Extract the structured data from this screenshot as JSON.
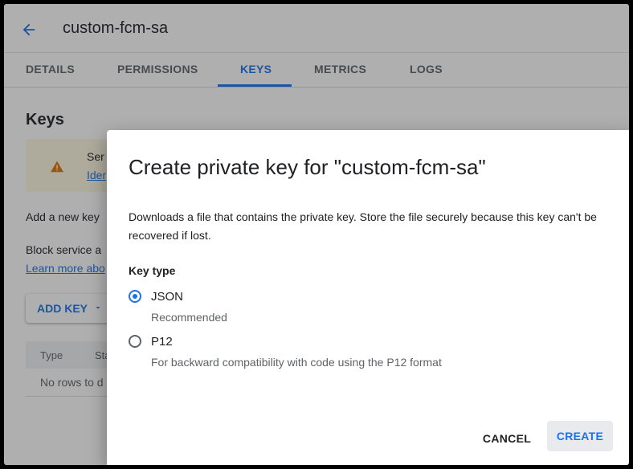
{
  "header": {
    "title": "custom-fcm-sa",
    "back_icon": "arrow-left-icon"
  },
  "tabs": [
    {
      "label": "DETAILS"
    },
    {
      "label": "PERMISSIONS"
    },
    {
      "label": "KEYS",
      "active": true
    },
    {
      "label": "METRICS"
    },
    {
      "label": "LOGS"
    }
  ],
  "page": {
    "section_title": "Keys",
    "warning_text": "Ser",
    "warning_link": "Ider",
    "add_key_text": "Add a new key",
    "block_text": "Block service a",
    "learn_more": "Learn more abo",
    "add_key_button": "ADD KEY",
    "table": {
      "columns": [
        "Type",
        "Sta"
      ],
      "empty_text": "No rows to d"
    }
  },
  "dialog": {
    "title": "Create private key for \"custom-fcm-sa\"",
    "description": "Downloads a file that contains the private key. Store the file securely because this key can't be recovered if lost.",
    "key_type_label": "Key type",
    "options": [
      {
        "label": "JSON",
        "help": "Recommended",
        "selected": true
      },
      {
        "label": "P12",
        "help": "For backward compatibility with code using the P12 format",
        "selected": false
      }
    ],
    "cancel_label": "CANCEL",
    "create_label": "CREATE"
  },
  "colors": {
    "accent": "#1a73e8",
    "warning": "#e37400",
    "text": "#202124",
    "muted": "#5f6368"
  }
}
